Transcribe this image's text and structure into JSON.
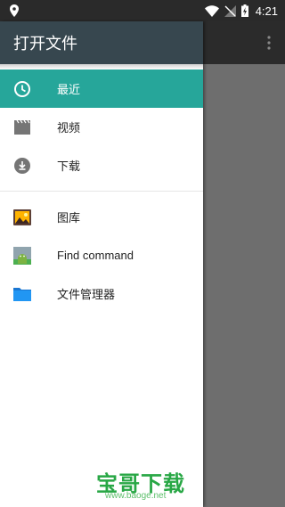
{
  "status_bar": {
    "time": "4:21"
  },
  "drawer": {
    "title": "打开文件",
    "items": [
      {
        "label": "最近",
        "icon": "clock-icon",
        "active": true
      },
      {
        "label": "视频",
        "icon": "video-icon",
        "active": false
      },
      {
        "label": "下载",
        "icon": "download-icon",
        "active": false
      }
    ],
    "roots": [
      {
        "label": "图库",
        "icon": "gallery-icon"
      },
      {
        "label": "Find command",
        "icon": "android-app-icon"
      },
      {
        "label": "文件管理器",
        "icon": "folder-icon"
      }
    ]
  },
  "watermark": {
    "main": "宝哥下载",
    "sub": "www.baoge.net"
  },
  "colors": {
    "accent": "#26a69a",
    "header": "#37474f",
    "scrim": "#6e6e6e"
  }
}
